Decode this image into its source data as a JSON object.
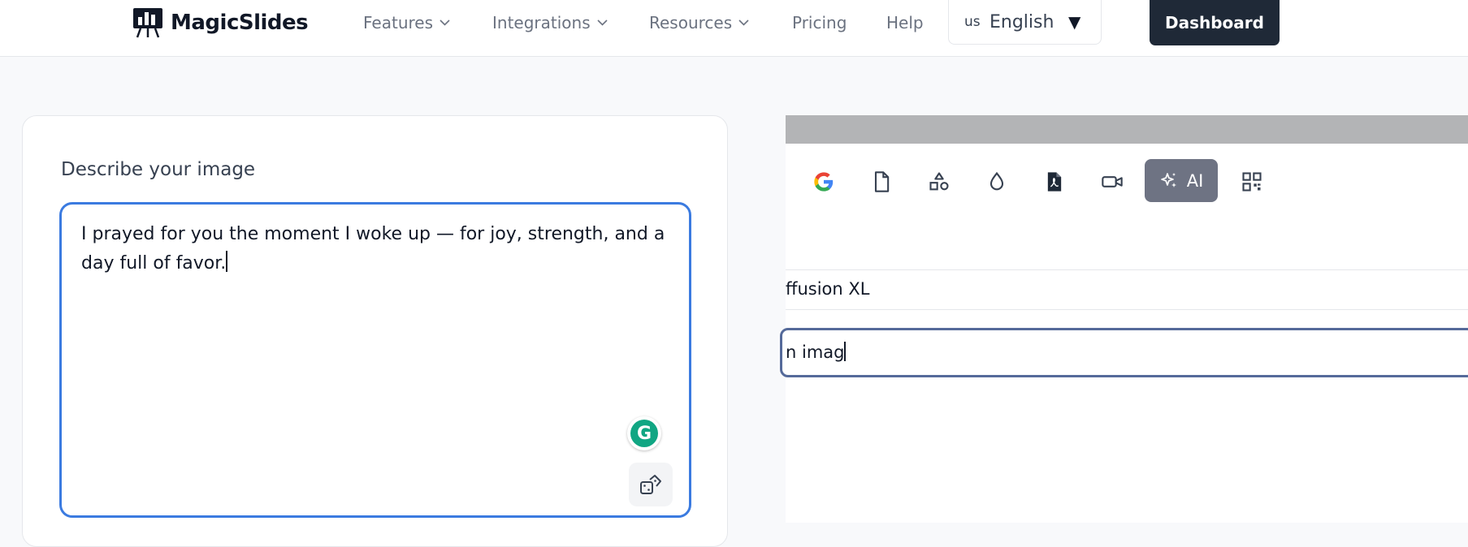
{
  "nav": {
    "brand": "MagicSlides",
    "items": [
      {
        "label": "Features",
        "has_dropdown": true
      },
      {
        "label": "Integrations",
        "has_dropdown": true
      },
      {
        "label": "Resources",
        "has_dropdown": true
      },
      {
        "label": "Pricing",
        "has_dropdown": false
      },
      {
        "label": "Help",
        "has_dropdown": false
      }
    ],
    "language": {
      "code": "us",
      "name": "English",
      "caret": "▼"
    },
    "dashboard_label": "Dashboard"
  },
  "left_card": {
    "label": "Describe your image",
    "prompt_value": "I prayed for you the moment I woke up — for joy, strength, and a day full of favor.",
    "grammarly_letter": "G",
    "icons": [
      "grammarly-icon",
      "dice-icon"
    ]
  },
  "right_panel": {
    "toolbar_icons": [
      "google-icon",
      "file-icon",
      "shapes-icon",
      "drop-icon",
      "pdf-icon",
      "video-icon",
      "ai-sparkle-icon",
      "qr-code-icon"
    ],
    "ai_label": "AI",
    "model_value": "ffusion XL",
    "input_value": "n imag"
  },
  "colors": {
    "accent_blue": "#3b7be0",
    "dashboard_bg": "#1f2937",
    "ai_button_bg": "#6e7383",
    "grammarly_green": "#11a683"
  }
}
